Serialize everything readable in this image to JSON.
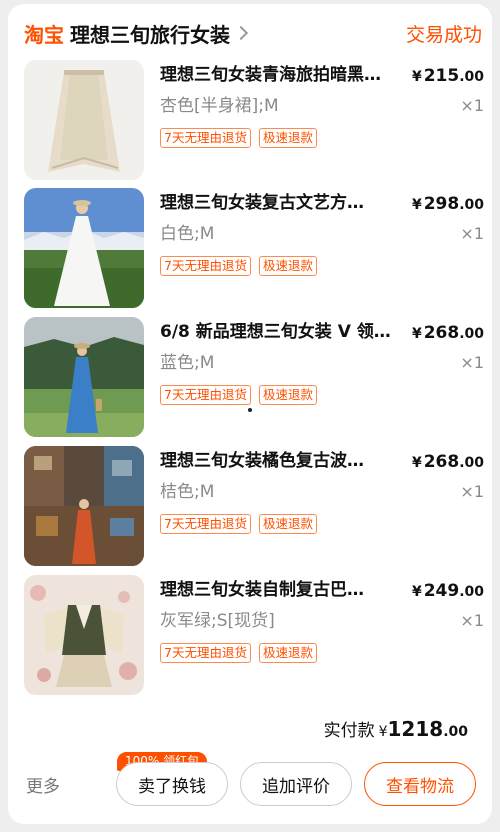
{
  "header": {
    "brand": "淘宝",
    "shop_name": "理想三旬旅行女装",
    "status": "交易成功"
  },
  "items": [
    {
      "title": "理想三旬女装青海旅拍暗黑…",
      "currency": "¥",
      "price_int": "215",
      "price_dec": ".00",
      "spec": "杏色[半身裙];M",
      "qty": "×1",
      "tags": [
        "7天无理由退货",
        "极速退款"
      ]
    },
    {
      "title": "理想三旬女装复古文艺方…",
      "currency": "¥",
      "price_int": "298",
      "price_dec": ".00",
      "spec": "白色;M",
      "qty": "×1",
      "tags": [
        "7天无理由退货",
        "极速退款"
      ]
    },
    {
      "title": "6/8 新品理想三旬女装 V 领…",
      "currency": "¥",
      "price_int": "268",
      "price_dec": ".00",
      "spec": "蓝色;M",
      "qty": "×1",
      "tags": [
        "7天无理由退货",
        "极速退款"
      ]
    },
    {
      "title": "理想三旬女装橘色复古波…",
      "currency": "¥",
      "price_int": "268",
      "price_dec": ".00",
      "spec": "桔色;M",
      "qty": "×1",
      "tags": [
        "7天无理由退货",
        "极速退款"
      ]
    },
    {
      "title": "理想三旬女装自制复古巴…",
      "currency": "¥",
      "price_int": "249",
      "price_dec": ".00",
      "spec": "灰军绿;S[现货]",
      "qty": "×1",
      "tags": [
        "7天无理由退货",
        "极速退款"
      ]
    }
  ],
  "summary": {
    "label": "实付款",
    "currency": "¥",
    "amount_int": "1218",
    "amount_dec": ".00"
  },
  "footer": {
    "more": "更多",
    "sell_badge": "100% 领红包",
    "sell_button": "卖了换钱",
    "review_button": "追加评价",
    "logistics_button": "查看物流"
  },
  "colors": {
    "accent": "#ff5000",
    "muted": "#8a8a8a",
    "background": "#eeeeee"
  }
}
